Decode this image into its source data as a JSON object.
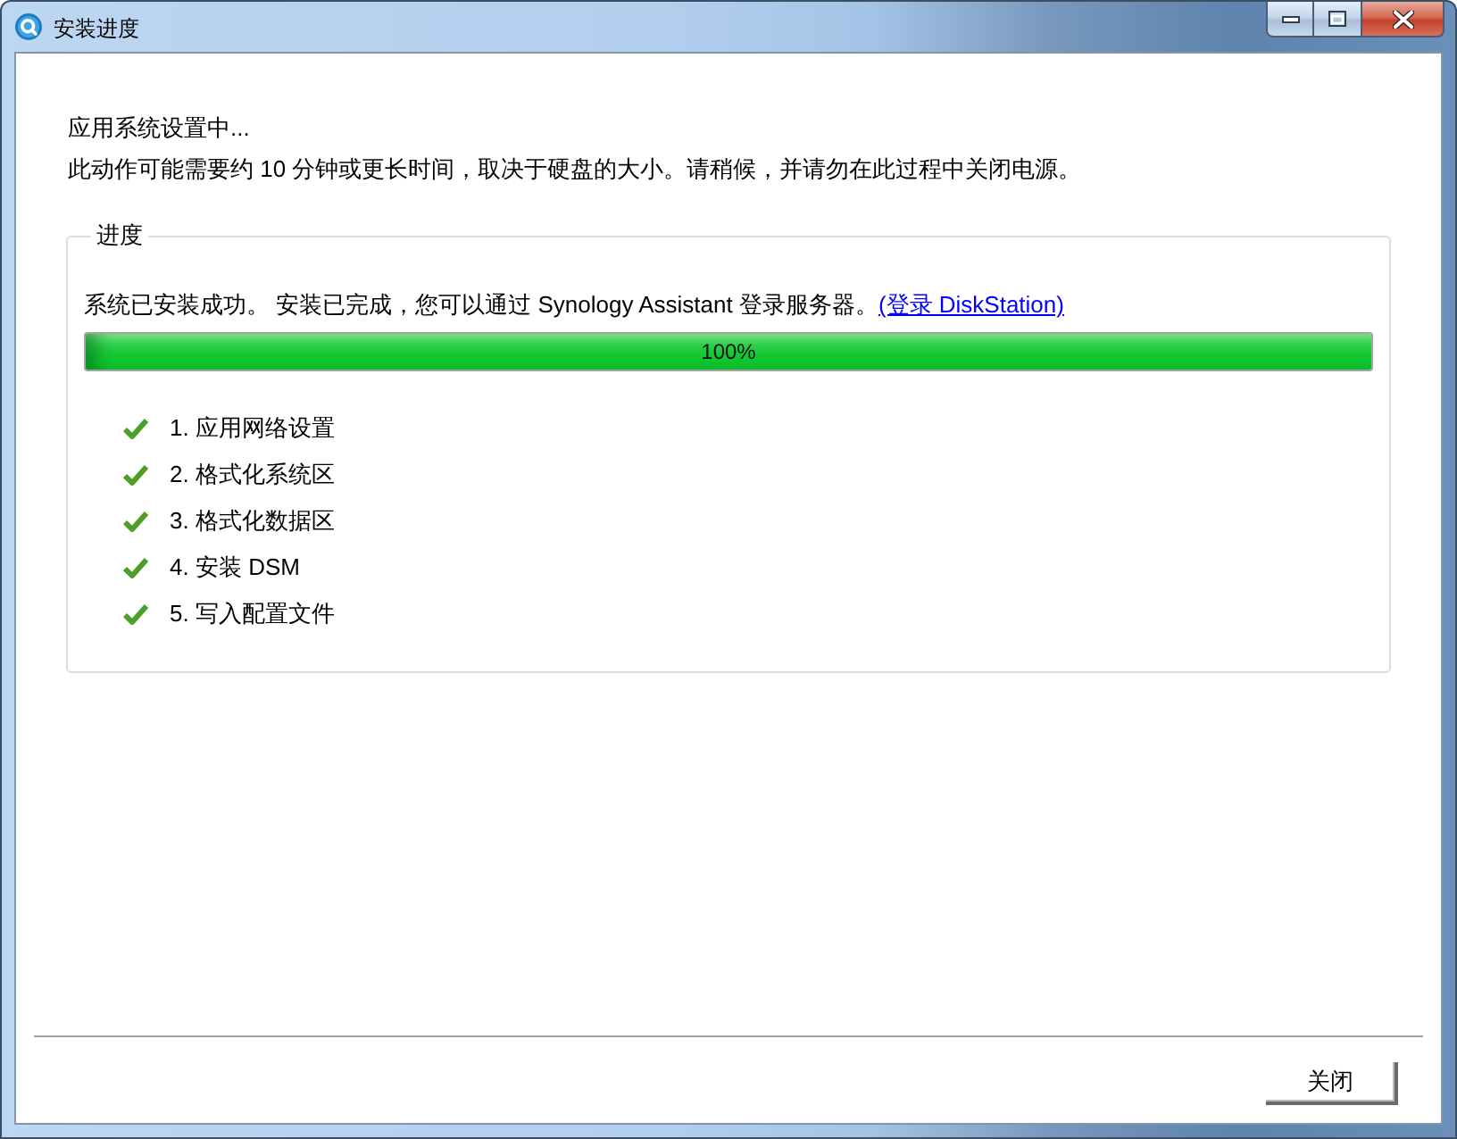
{
  "window": {
    "title": "安装进度"
  },
  "header": {
    "status": "应用系统设置中...",
    "notice": "此动作可能需要约 10 分钟或更长时间，取决于硬盘的大小。请稍候，并请勿在此过程中关闭电源。"
  },
  "progress_group": {
    "legend": "进度",
    "message": "系统已安装成功。 安装已完成，您可以通过 Synology Assistant 登录服务器。",
    "link": "(登录 DiskStation)",
    "progress": {
      "level": 1,
      "reading": "100%"
    },
    "steps": [
      {
        "label": "1. 应用网络设置",
        "done": true
      },
      {
        "label": "2. 格式化系统区",
        "done": true
      },
      {
        "label": "3. 格式化数据区",
        "done": true
      },
      {
        "label": "4. 安装 DSM",
        "done": true
      },
      {
        "label": "5. 写入配置文件",
        "done": true
      }
    ]
  },
  "buttons": [
    {
      "label": "关闭"
    }
  ]
}
